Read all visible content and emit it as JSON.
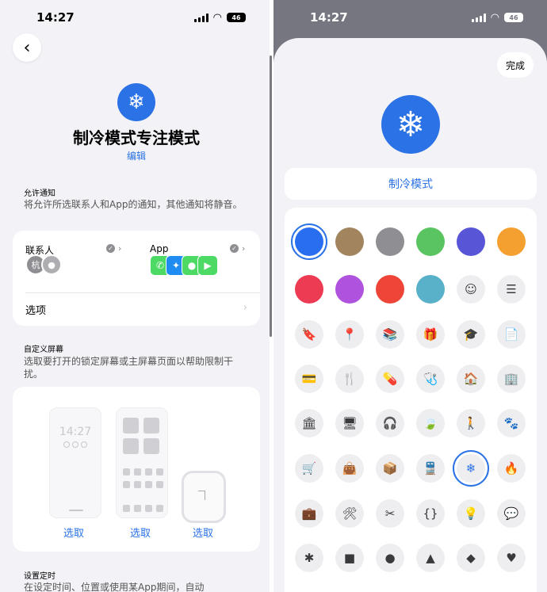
{
  "status": {
    "time": "14:27",
    "battery": "46"
  },
  "left": {
    "title": "制冷模式专注模式",
    "edit": "编辑",
    "allow_notifications": {
      "heading": "允许通知",
      "desc": "将允许所选联系人和App的通知，其他通知将静音。",
      "contacts_label": "联系人",
      "apps_label": "App",
      "avatar1": "杭",
      "options_label": "选项"
    },
    "customize_screens": {
      "heading": "自定义屏幕",
      "desc": "选取要打开的锁定屏幕或主屏幕页面以帮助限制干扰。",
      "lock_time": "14:27",
      "pick1": "选取",
      "pick2": "选取",
      "pick3": "选取"
    },
    "schedule": {
      "heading": "设置定时",
      "desc": "在设定时间、位置或使用某App期间，自动"
    }
  },
  "right": {
    "done": "完成",
    "name": "制冷模式",
    "colors": [
      "#2a6ef0",
      "#a2845e",
      "#8e8e93",
      "#5ac560",
      "#5856d6",
      "#f4a030",
      "#ec3b53",
      "#af52de",
      "#ef4438",
      "#58b0c9"
    ],
    "extra_row1": [
      {
        "name": "smiley-icon",
        "glyph": "☺"
      },
      {
        "name": "list-icon",
        "glyph": "☰"
      }
    ],
    "icon_rows": [
      [
        {
          "name": "bookmark-icon",
          "glyph": "🔖"
        },
        {
          "name": "pin-icon",
          "glyph": "📍"
        },
        {
          "name": "books-icon",
          "glyph": "📚"
        },
        {
          "name": "gift-icon",
          "glyph": "🎁"
        },
        {
          "name": "graduation-cap-icon",
          "glyph": "🎓"
        },
        {
          "name": "document-icon",
          "glyph": "📄"
        }
      ],
      [
        {
          "name": "credit-card-icon",
          "glyph": "💳"
        },
        {
          "name": "fork-knife-icon",
          "glyph": "🍴"
        },
        {
          "name": "pills-icon",
          "glyph": "💊"
        },
        {
          "name": "stethoscope-icon",
          "glyph": "🩺"
        },
        {
          "name": "house-icon",
          "glyph": "🏠"
        },
        {
          "name": "building-icon",
          "glyph": "🏢"
        }
      ],
      [
        {
          "name": "bank-icon",
          "glyph": "🏛"
        },
        {
          "name": "monitor-icon",
          "glyph": "🖥"
        },
        {
          "name": "headphones-icon",
          "glyph": "🎧"
        },
        {
          "name": "leaf-icon",
          "glyph": "🍃"
        },
        {
          "name": "person-icon",
          "glyph": "🚶"
        },
        {
          "name": "paw-icon",
          "glyph": "🐾"
        }
      ],
      [
        {
          "name": "cart-icon",
          "glyph": "🛒"
        },
        {
          "name": "bag-icon",
          "glyph": "👜"
        },
        {
          "name": "box-icon",
          "glyph": "📦"
        },
        {
          "name": "train-icon",
          "glyph": "🚆"
        },
        {
          "name": "snowflake-icon",
          "glyph": "❄"
        },
        {
          "name": "flame-icon",
          "glyph": "🔥"
        }
      ],
      [
        {
          "name": "briefcase-icon",
          "glyph": "💼"
        },
        {
          "name": "tools-icon",
          "glyph": "🛠"
        },
        {
          "name": "scissors-icon",
          "glyph": "✂"
        },
        {
          "name": "braces-icon",
          "glyph": "{}"
        },
        {
          "name": "lightbulb-icon",
          "glyph": "💡"
        },
        {
          "name": "speech-bubble-icon",
          "glyph": "💬"
        }
      ],
      [
        {
          "name": "asterisk-icon",
          "glyph": "✱"
        },
        {
          "name": "square-icon",
          "glyph": "■"
        },
        {
          "name": "circle-icon",
          "glyph": "●"
        },
        {
          "name": "triangle-icon",
          "glyph": "▲"
        },
        {
          "name": "diamond-icon",
          "glyph": "◆"
        },
        {
          "name": "heart-icon",
          "glyph": "♥"
        }
      ]
    ],
    "selected_icon": "snowflake-icon",
    "selected_color": "#2a6ef0"
  }
}
